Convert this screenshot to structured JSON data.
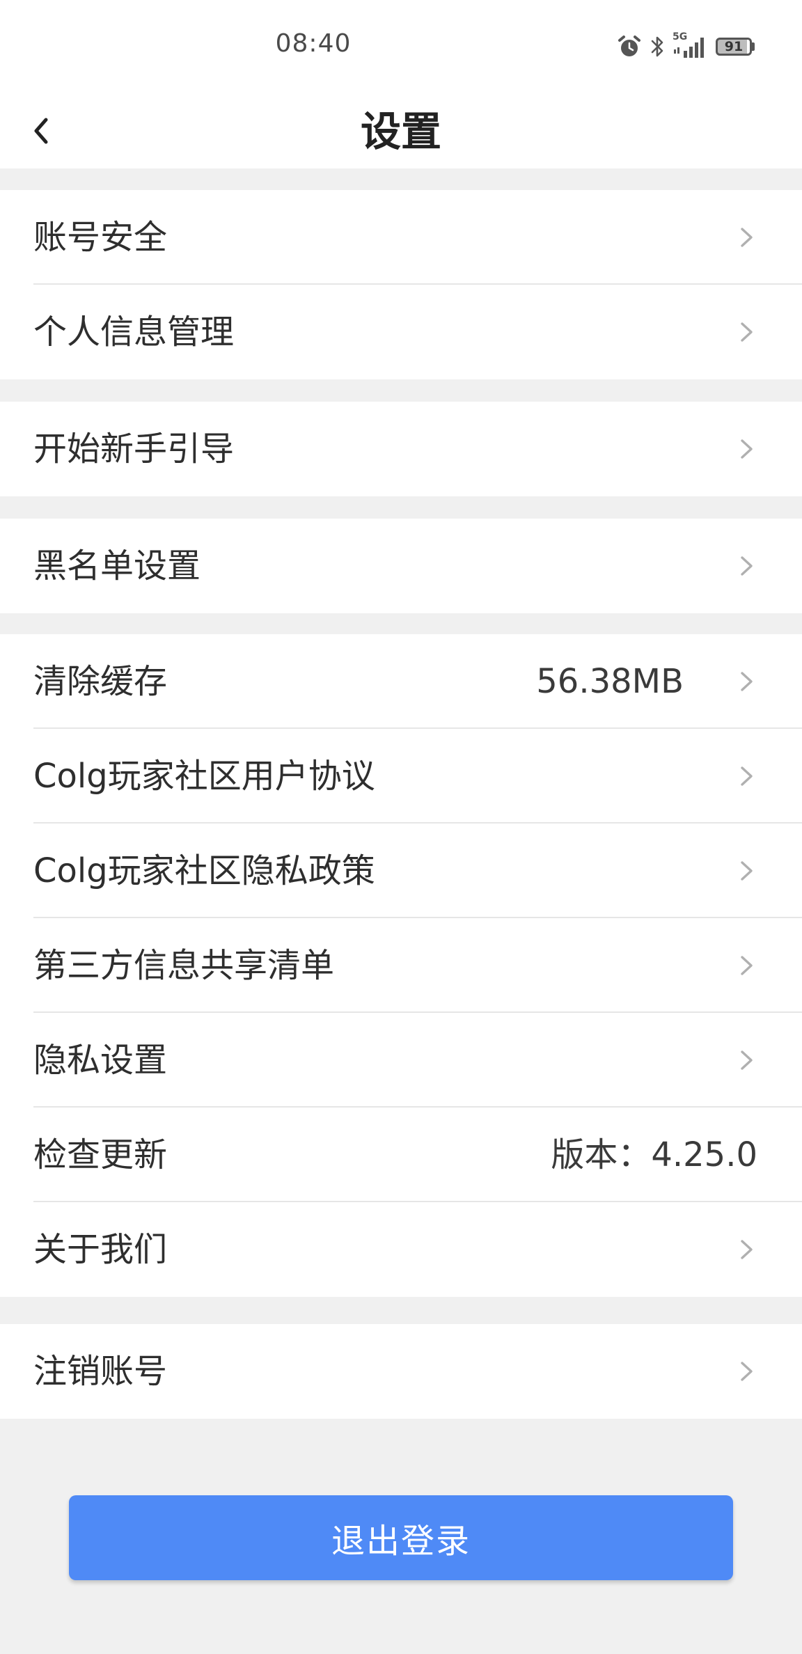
{
  "status_bar": {
    "time": "08:40",
    "battery": "91",
    "network": "5G",
    "icons": [
      "alarm-icon",
      "bluetooth-icon",
      "signal-icon",
      "battery-icon"
    ]
  },
  "header": {
    "title": "设置",
    "back_icon": "chevron-left-icon"
  },
  "groups": [
    {
      "items": [
        {
          "label": "账号安全",
          "value": "",
          "chevron": true
        },
        {
          "label": "个人信息管理",
          "value": "",
          "chevron": true
        }
      ]
    },
    {
      "items": [
        {
          "label": "开始新手引导",
          "value": "",
          "chevron": true
        }
      ]
    },
    {
      "items": [
        {
          "label": "黑名单设置",
          "value": "",
          "chevron": true
        }
      ]
    },
    {
      "items": [
        {
          "label": "清除缓存",
          "value": "56.38MB",
          "chevron": true
        },
        {
          "label": "Colg玩家社区用户协议",
          "value": "",
          "chevron": true
        },
        {
          "label": "Colg玩家社区隐私政策",
          "value": "",
          "chevron": true
        },
        {
          "label": "第三方信息共享清单",
          "value": "",
          "chevron": true
        },
        {
          "label": "隐私设置",
          "value": "",
          "chevron": true
        },
        {
          "label": "检查更新",
          "value": "版本：4.25.0",
          "chevron": false
        },
        {
          "label": "关于我们",
          "value": "",
          "chevron": true
        }
      ]
    },
    {
      "items": [
        {
          "label": "注销账号",
          "value": "",
          "chevron": true
        }
      ]
    }
  ],
  "logout_label": "退出登录",
  "colors": {
    "accent": "#4f8af6",
    "background": "#f0f0f0",
    "surface": "#ffffff",
    "chevron": "#b0b0b0"
  }
}
